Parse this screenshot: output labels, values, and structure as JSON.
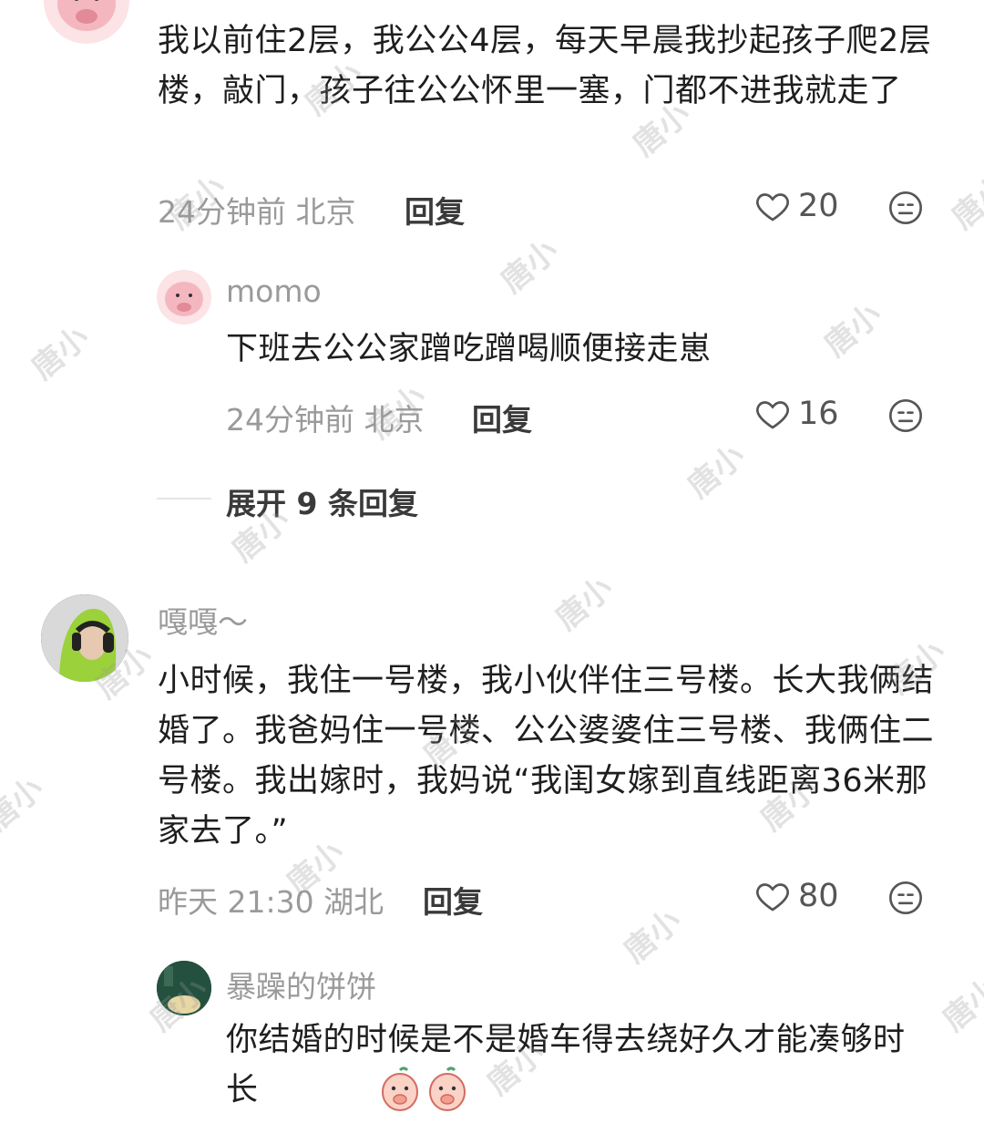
{
  "comments": [
    {
      "text": "我以前住2层，我公公4层，每天早晨我抄起孩子爬2层楼，敲门，孩子往公公怀里一塞，门都不进我就走了",
      "meta": "24分钟前 北京",
      "reply_label": "回复",
      "likes": "20",
      "replies": [
        {
          "name": "momo",
          "text": "下班去公公家蹭吃蹭喝顺便接走崽",
          "meta": "24分钟前 北京",
          "reply_label": "回复",
          "likes": "16"
        }
      ],
      "expand_label": "展开 9 条回复"
    },
    {
      "name": "嘎嘎～",
      "text": "小时候，我住一号楼，我小伙伴住三号楼。长大我俩结婚了。我爸妈住一号楼、公公婆婆住三号楼、我俩住二号楼。我出嫁时，我妈说“我闺女嫁到直线距离36米那家去了。”",
      "meta": "昨天 21:30 湖北",
      "reply_label": "回复",
      "likes": "80",
      "replies": [
        {
          "name": "暴躁的饼饼",
          "text": "你结婚的时候是不是婚车得去绕好久才能凑够时长"
        }
      ]
    }
  ],
  "watermark": "唐小",
  "colors": {
    "text": "#1e1e1e",
    "meta": "#9a9a9a",
    "icon": "#555555"
  }
}
